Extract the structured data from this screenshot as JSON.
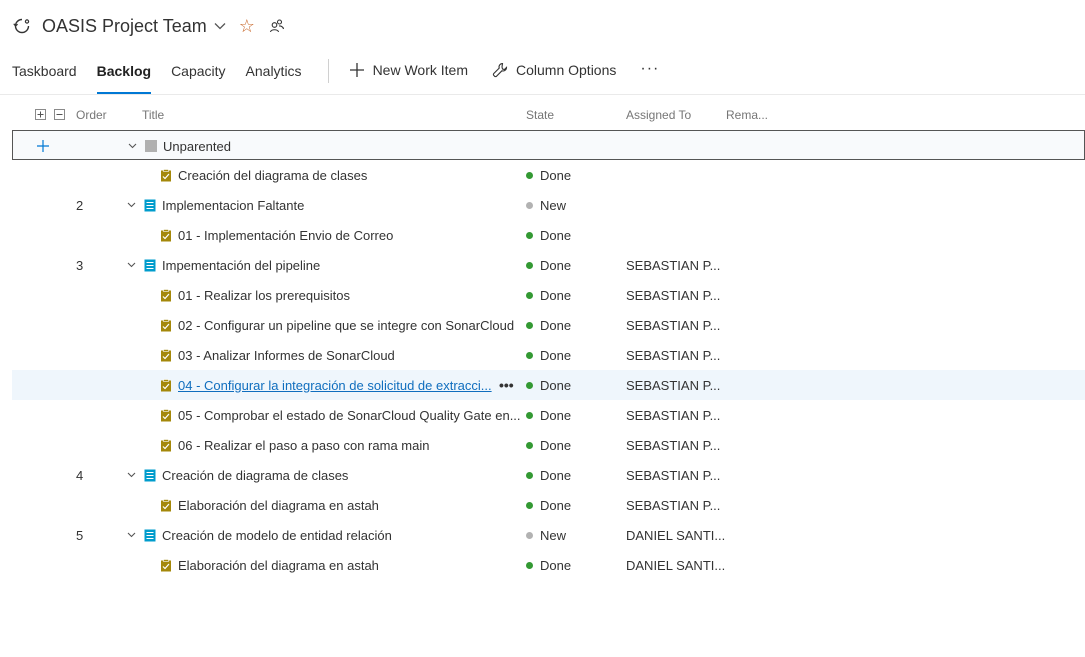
{
  "header": {
    "team_name": "OASIS Project Team",
    "team_icon": "team-refresh-icon",
    "dropdown_icon": "chevron-down-icon",
    "favorite_icon": "star-icon",
    "members_icon": "people-icon"
  },
  "tabs": [
    {
      "label": "Taskboard"
    },
    {
      "label": "Backlog"
    },
    {
      "label": "Capacity"
    },
    {
      "label": "Analytics"
    }
  ],
  "toolbar": {
    "new_work_item": "New Work Item",
    "column_options": "Column Options",
    "more": "···"
  },
  "columns": {
    "order": "Order",
    "title": "Title",
    "state": "State",
    "assigned_to": "Assigned To",
    "remaining": "Rema..."
  },
  "colors": {
    "accent": "#0078d4",
    "done": "#339933",
    "new": "#b2b2b2",
    "task_icon": "#a4880a",
    "pbi_icon": "#009ccc",
    "unparented_icon": "#b0b0b0"
  },
  "rows": [
    {
      "order": "",
      "title": "Unparented",
      "state": "",
      "state_color": "",
      "assigned": "",
      "type": "unparented"
    },
    {
      "order": "",
      "title": "Creación del diagrama de clases",
      "state": "Done",
      "assigned": "",
      "type": "task"
    },
    {
      "order": "2",
      "title": "Implementacion Faltante",
      "state": "New",
      "assigned": "",
      "type": "pbi"
    },
    {
      "order": "",
      "title": "01 - Implementación Envio de Correo",
      "state": "Done",
      "assigned": "",
      "type": "task"
    },
    {
      "order": "3",
      "title": "Impementación del pipeline",
      "state": "Done",
      "assigned": "SEBASTIAN P...",
      "type": "pbi"
    },
    {
      "order": "",
      "title": "01 - Realizar los prerequisitos",
      "state": "Done",
      "assigned": "SEBASTIAN P...",
      "type": "task"
    },
    {
      "order": "",
      "title": "02 - Configurar un pipeline que se integre con SonarCloud",
      "state": "Done",
      "assigned": "SEBASTIAN P...",
      "type": "task"
    },
    {
      "order": "",
      "title": "03 - Analizar Informes de SonarCloud",
      "state": "Done",
      "assigned": "SEBASTIAN P...",
      "type": "task"
    },
    {
      "order": "",
      "title": "04 - Configurar la integración de solicitud de extracci...",
      "state": "Done",
      "assigned": "SEBASTIAN P...",
      "type": "task",
      "row_more": "•••"
    },
    {
      "order": "",
      "title": "05 - Comprobar el estado de SonarCloud Quality Gate en...",
      "state": "Done",
      "assigned": "SEBASTIAN P...",
      "type": "task"
    },
    {
      "order": "",
      "title": "06 - Realizar el paso a paso con rama main",
      "state": "Done",
      "assigned": "SEBASTIAN P...",
      "type": "task"
    },
    {
      "order": "4",
      "title": "Creación de diagrama de clases",
      "state": "Done",
      "assigned": "SEBASTIAN P...",
      "type": "pbi"
    },
    {
      "order": "",
      "title": "Elaboración del diagrama en astah",
      "state": "Done",
      "assigned": "SEBASTIAN P...",
      "type": "task"
    },
    {
      "order": "5",
      "title": "Creación de modelo de entidad relación",
      "state": "New",
      "assigned": "DANIEL SANTI...",
      "type": "pbi"
    },
    {
      "order": "",
      "title": "Elaboración del diagrama en astah",
      "state": "Done",
      "assigned": "DANIEL SANTI...",
      "type": "task"
    }
  ]
}
